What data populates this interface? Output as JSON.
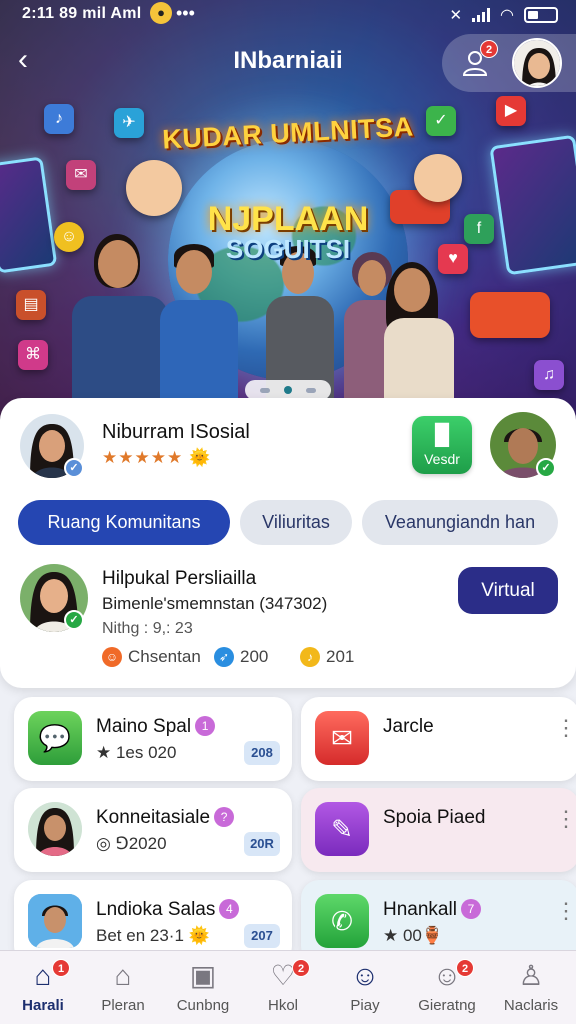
{
  "status_bar": {
    "time": "2:11 89 mil Aml",
    "more": "•••"
  },
  "header": {
    "title": "INbarniaii",
    "notification_count": "2",
    "back_glyph": "‹",
    "person_glyph": "👤"
  },
  "banner": {
    "line1": "KUDAR UMLNITSA",
    "line2": "NJPLAAN",
    "line3": "SOGUITSI"
  },
  "community": {
    "name": "Niburram ISosial",
    "rating": "★★★★★",
    "rating_badge": "🌞",
    "action_label": "Vesdr",
    "action_icon": "phone-book-icon"
  },
  "chips": [
    {
      "label": "Ruang Komunitans",
      "active": true
    },
    {
      "label": "Viliuritas",
      "active": false
    },
    {
      "label": "Veanungiandn han",
      "active": false
    }
  ],
  "post": {
    "name": "Hilpukal Persliailla",
    "subtitle": "Bimenle'smemnstan (347302)",
    "meta": "Nithg : 9,: 23",
    "button": "Virtual",
    "reactions": [
      {
        "label": "Chsentan",
        "icon": "emoji-icon"
      },
      {
        "label": "200",
        "icon": "compass-icon"
      },
      {
        "label": "201",
        "icon": "bell-icon"
      }
    ]
  },
  "cards": [
    {
      "title": "Maino Spal",
      "badge_num": "1",
      "sub": "★ 1es 020",
      "count": "208",
      "icon": "chat-bubble-icon",
      "color": "#3dbb4a"
    },
    {
      "title": "Jarcle",
      "sub": "",
      "icon": "mail-icon",
      "color": "#e53935"
    },
    {
      "title": "Konneitasiale",
      "badge_num": "?",
      "sub": "◎ ⅁2020",
      "count": "20R",
      "icon": "avatar",
      "color": "#f1c0a0"
    },
    {
      "title": "Spoia Piaed",
      "sub": "",
      "icon": "pen-icon",
      "color": "#9b3fd1"
    },
    {
      "title": "Lndioka Salas",
      "badge_num": "4",
      "sub": "Bet en 23·1 🌞",
      "count": "207",
      "icon": "avatar",
      "color": "#4fa3e0"
    },
    {
      "title": "Hnankall",
      "badge_num": "7",
      "sub": "★ 00🏺",
      "count": "",
      "icon": "whatsapp-icon",
      "color": "#3bb54a"
    }
  ],
  "nav": [
    {
      "label": "Harali",
      "icon": "home-icon",
      "glyph": "⌂",
      "badge": "1",
      "active": true
    },
    {
      "label": "Pleran",
      "icon": "house-icon",
      "glyph": "⌂",
      "badge": "",
      "active": false
    },
    {
      "label": "Cunbng",
      "icon": "building-icon",
      "glyph": "▣",
      "badge": "",
      "active": false
    },
    {
      "label": "Hkol",
      "icon": "heart-icon",
      "glyph": "♡",
      "badge": "2",
      "active": false
    },
    {
      "label": "Piay",
      "icon": "smile-icon",
      "glyph": "☺",
      "badge": "",
      "active": false
    },
    {
      "label": "Gieratng",
      "icon": "face-icon",
      "glyph": "☺",
      "badge": "2",
      "active": false
    },
    {
      "label": "Naclaris",
      "icon": "user-icon",
      "glyph": "♙",
      "badge": "",
      "active": false
    }
  ],
  "colors": {
    "primary": "#2546b2",
    "dark_button": "#2b2d88",
    "success": "#27a844",
    "alert": "#e53935"
  }
}
